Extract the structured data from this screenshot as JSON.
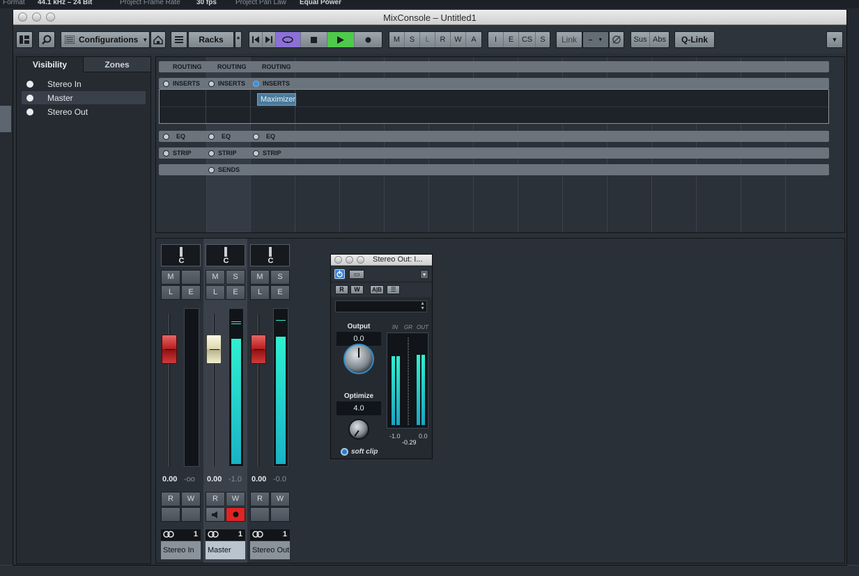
{
  "host_strip": {
    "labels": [
      "Format",
      "44.1 kHz – 24 Bit",
      "Project Frame Rate",
      "30 fps",
      "Project Pan Law",
      "Equal Power"
    ]
  },
  "window": {
    "title": "MixConsole – Untitled1"
  },
  "toolbar": {
    "configurations": "Configurations",
    "racks": "Racks",
    "racks_star": "*",
    "global_buttons": [
      "M",
      "S",
      "L",
      "R",
      "W",
      "A"
    ],
    "mode_buttons": [
      "I",
      "E",
      "CS",
      "S"
    ],
    "link": "Link",
    "link_value": "–",
    "sus": "Sus",
    "abs": "Abs",
    "qlink": "Q-Link"
  },
  "left_panel": {
    "tabs": [
      "Visibility",
      "Zones"
    ],
    "items": [
      {
        "label": "Stereo In",
        "selected": false
      },
      {
        "label": "Master",
        "selected": true
      },
      {
        "label": "Stereo Out",
        "selected": false
      }
    ]
  },
  "racks": {
    "routing": [
      "ROUTING",
      "ROUTING",
      "ROUTING"
    ],
    "inserts": [
      "INSERTS",
      "INSERTS",
      "INSERTS"
    ],
    "inserts_active": [
      false,
      false,
      true
    ],
    "insert_slot": "Maximizer",
    "eq": [
      "EQ",
      "EQ",
      "EQ"
    ],
    "strip": [
      "STRIP",
      "STRIP",
      "STRIP"
    ],
    "sends": "SENDS"
  },
  "channels": [
    {
      "name": "Stereo In",
      "pan": "C",
      "volume": "0.00",
      "peak": "-oo",
      "number": "1",
      "fader_color": "red",
      "meter_level": 0,
      "mute": "M",
      "solo": "",
      "listen": "L",
      "edit": "E",
      "read": "R",
      "write": "W"
    },
    {
      "name": "Master",
      "pan": "C",
      "volume": "0.00",
      "peak": "-1.0",
      "number": "1",
      "fader_color": "cream",
      "meter_level": 0.82,
      "mute": "M",
      "solo": "S",
      "listen": "L",
      "edit": "E",
      "read": "R",
      "write": "W"
    },
    {
      "name": "Stereo Out",
      "pan": "C",
      "volume": "0.00",
      "peak": "-0.0",
      "number": "1",
      "fader_color": "red",
      "meter_level": 0.83,
      "mute": "M",
      "solo": "S",
      "listen": "L",
      "edit": "E",
      "read": "R",
      "write": "W"
    }
  ],
  "plugin": {
    "title": "Stereo Out: I...",
    "r": "R",
    "w": "W",
    "output_label": "Output",
    "output_value": "0.0",
    "optimize_label": "Optimize",
    "optimize_value": "4.0",
    "meter_headers": [
      "IN",
      "GR",
      "OUT"
    ],
    "scale_left": "-1.0",
    "scale_right": "0.0",
    "reduction": "-0.29",
    "softclip": "soft clip",
    "in_level": 0.74,
    "out_level": 0.75,
    "colors": {
      "meter": "#2ff0d0",
      "accent": "#2f8ec7"
    }
  },
  "colors": {
    "cycle": "#8b71d6",
    "play": "#4fc94b",
    "record": "#e02424"
  }
}
